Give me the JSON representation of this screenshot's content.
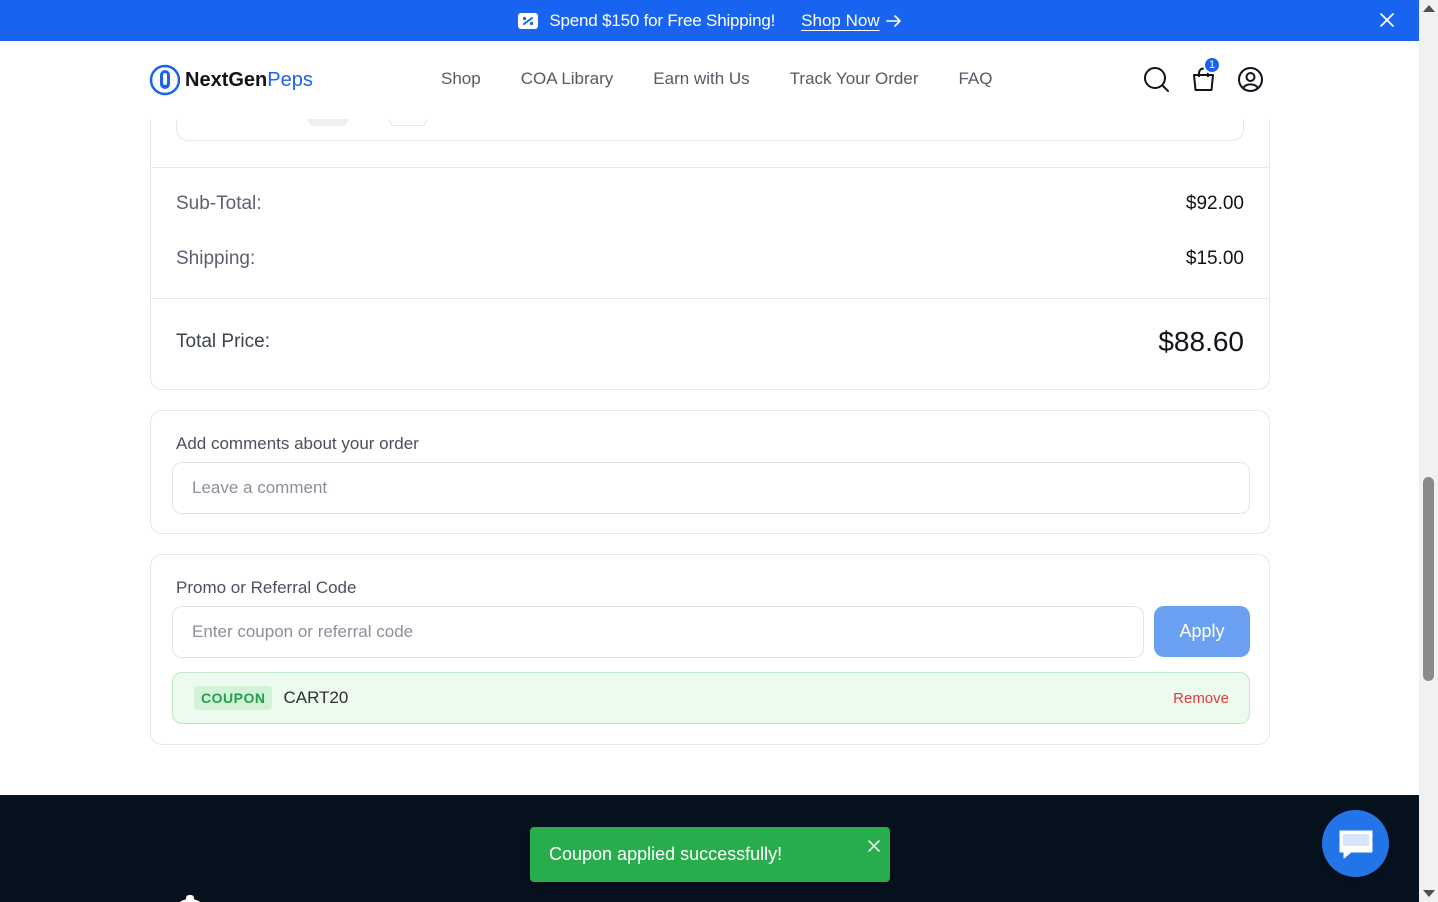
{
  "announcement": {
    "text": "Spend $150 for Free Shipping!",
    "link_label": "Shop Now",
    "icon": "gift-icon",
    "background": "#1864f0"
  },
  "header": {
    "brand_part1": "NextGen",
    "brand_part2": "Peps",
    "nav": [
      "Shop",
      "COA Library",
      "Earn with Us",
      "Track Your Order",
      "FAQ"
    ],
    "cart_count": "1"
  },
  "summary": {
    "subtotal_label": "Sub-Total:",
    "subtotal_value": "$92.00",
    "shipping_label": "Shipping:",
    "shipping_value": "$15.00",
    "total_label": "Total Price:",
    "total_value": "$88.60"
  },
  "comments": {
    "title": "Add comments about your order",
    "placeholder": "Leave a comment"
  },
  "promo": {
    "title": "Promo or Referral Code",
    "placeholder": "Enter coupon or referral code",
    "apply_label": "Apply",
    "coupon_tag": "COUPON",
    "coupon_code": "CART20",
    "remove_label": "Remove"
  },
  "toast": {
    "message": "Coupon applied successfully!"
  },
  "colors": {
    "accent": "#1864f0",
    "success": "#27ad4c",
    "danger": "#e03a3a",
    "footer": "#07121f"
  }
}
